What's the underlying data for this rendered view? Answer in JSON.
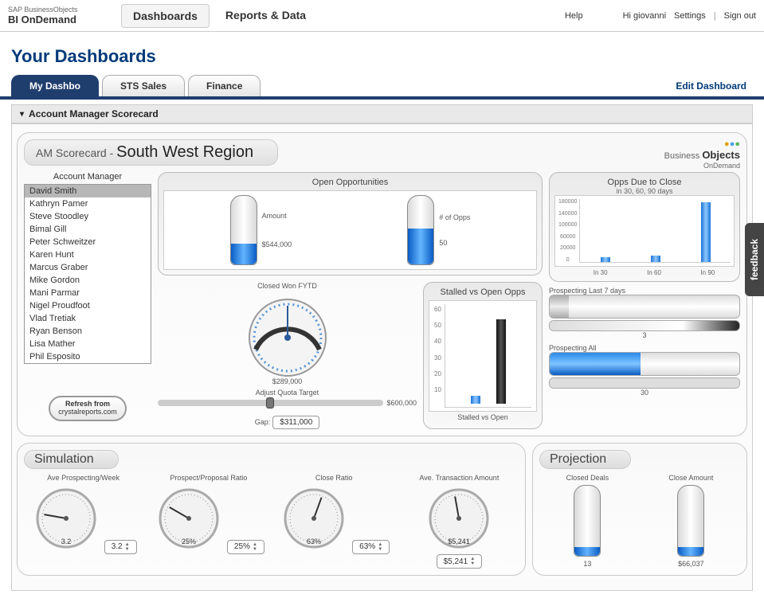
{
  "topbar": {
    "brand_top": "SAP BusinessObjects",
    "brand_bot": "BI OnDemand",
    "nav": [
      "Dashboards",
      "Reports & Data"
    ],
    "active_nav": 0,
    "help": "Help",
    "greeting": "Hi giovanni",
    "settings": "Settings",
    "signout": "Sign out"
  },
  "page_title": "Your Dashboards",
  "tabs": [
    "My Dashbo",
    "STS Sales",
    "Finance"
  ],
  "active_tab": 0,
  "edit_link": "Edit Dashboard",
  "accordion_title": "Account Manager Scorecard",
  "header": {
    "prefix": "AM Scorecard -",
    "region": "South West Region",
    "biz_obj": "Business Objects",
    "ondemand": "OnDemand"
  },
  "managers": {
    "title": "Account Manager",
    "selected": 0,
    "list": [
      "David Smith",
      "Kathryn Pamer",
      "Steve Stoodley",
      "Bimal Gill",
      "Peter Schweitzer",
      "Karen Hunt",
      "Marcus Graber",
      "Mike Gordon",
      "Mani Parmar",
      "Nigel Proudfoot",
      "Vlad Tretiak",
      "Ryan Benson",
      "Lisa Mather",
      "Phil Esposito"
    ]
  },
  "refresh_btn": {
    "l1": "Refresh from",
    "l2": "crystalreports.com"
  },
  "open_opps": {
    "title": "Open Opportunities",
    "amount_lbl": "Amount",
    "count_lbl": "# of Opps",
    "amount_txt": "$544,000",
    "count_txt": "50",
    "amount_fill_pct": 30,
    "count_fill_pct": 52
  },
  "closed_won": {
    "title": "Closed Won FYTD",
    "value": "$289,000",
    "adjust_lbl": "Adjust Quota Target",
    "max": "$600,000",
    "gap_lbl": "Gap:",
    "gap_val": "$311,000"
  },
  "stalled": {
    "title": "Stalled vs Open Opps",
    "footer": "Stalled vs Open",
    "y_ticks": [
      "60",
      "50",
      "40",
      "30",
      "20",
      "10"
    ]
  },
  "opps_due": {
    "title": "Opps Due to Close",
    "sub": "in 30, 60, 90 days",
    "y_ticks": [
      "180000",
      "140000",
      "100000",
      "60000",
      "20000",
      "0"
    ],
    "x_lbls": [
      "In 30",
      "In 60",
      "In 90"
    ]
  },
  "prospecting7": {
    "title": "Prospecting Last 7 days",
    "val": "3"
  },
  "prospecting_all": {
    "title": "Prospecting All",
    "val": "30"
  },
  "simulation": {
    "title": "Simulation",
    "items": [
      {
        "lbl": "Ave Prospecting/Week",
        "gauge": "3.2",
        "inp": "3.2"
      },
      {
        "lbl": "Prospect/Proposal Ratio",
        "gauge": "25%",
        "inp": "25%"
      },
      {
        "lbl": "Close Ratio",
        "gauge": "63%",
        "inp": "63%"
      },
      {
        "lbl": "Ave. Transaction Amount",
        "gauge": "$5,241",
        "inp": "$5,241"
      }
    ]
  },
  "projection": {
    "title": "Projection",
    "items": [
      {
        "lbl": "Closed Deals",
        "val": "13"
      },
      {
        "lbl": "Close Amount",
        "val": "$66,037"
      }
    ]
  },
  "feedback": "feedback",
  "chart_data": [
    {
      "type": "bar",
      "title": "Open Opportunities",
      "series": [
        {
          "name": "Amount",
          "values": [
            544000
          ]
        },
        {
          "name": "# of Opps",
          "values": [
            50
          ]
        }
      ]
    },
    {
      "type": "bar",
      "title": "Opps Due to Close",
      "categories": [
        "In 30",
        "In 60",
        "In 90"
      ],
      "values": [
        12000,
        18000,
        172000
      ],
      "ylim": [
        0,
        180000
      ]
    },
    {
      "type": "bar",
      "title": "Stalled vs Open Opps",
      "categories": [
        "Stalled",
        "Open"
      ],
      "values": [
        3,
        50
      ],
      "ylim": [
        0,
        60
      ]
    },
    {
      "type": "gauge",
      "title": "Closed Won FYTD",
      "value": 289000,
      "max": 600000,
      "gap": 311000
    }
  ]
}
